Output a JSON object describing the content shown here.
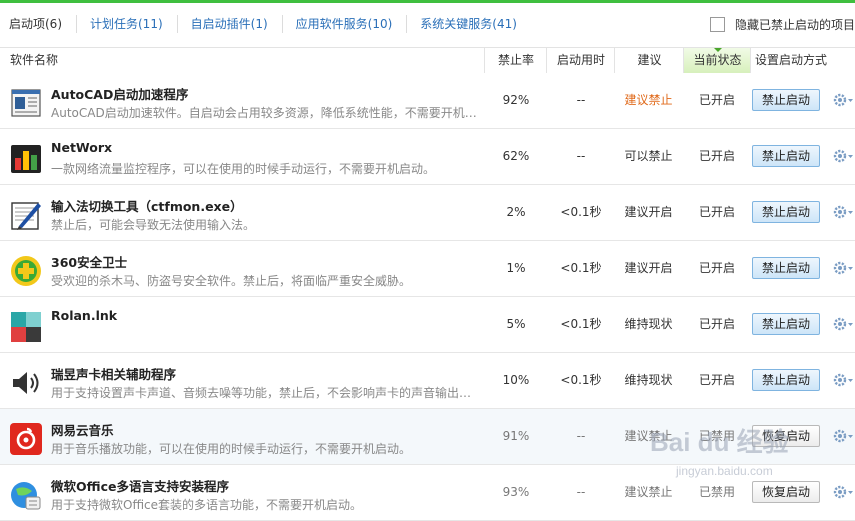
{
  "tabs": [
    {
      "label": "启动项(6)"
    },
    {
      "label": "计划任务(11)"
    },
    {
      "label": "自启动插件(1)"
    },
    {
      "label": "应用软件服务(10)"
    },
    {
      "label": "系统关键服务(41)"
    }
  ],
  "hide_disabled_label": "隐藏已禁止启动的项目",
  "columns": {
    "name": "软件名称",
    "disable_rate": "禁止率",
    "startup_time": "启动用时",
    "suggestion": "建议",
    "current_state": "当前状态",
    "startup_mode": "设置启动方式"
  },
  "rows": [
    {
      "name": "AutoCAD启动加速程序",
      "desc": "AutoCAD启动加速软件。自启动会占用较多资源，降低系统性能，不需要开机启动。",
      "rate": "92%",
      "time": "--",
      "suggestion": "建议禁止",
      "state": "已开启",
      "button": "禁止启动",
      "icon": "autocad-icon",
      "suggestion_color": "#e06a1b"
    },
    {
      "name": "NetWorx",
      "desc": "一款网络流量监控程序，可以在使用的时候手动运行，不需要开机启动。",
      "rate": "62%",
      "time": "--",
      "suggestion": "可以禁止",
      "state": "已开启",
      "button": "禁止启动",
      "icon": "networx-icon"
    },
    {
      "name": "输入法切换工具（ctfmon.exe）",
      "desc": "禁止后，可能会导致无法使用输入法。",
      "rate": "2%",
      "time": "<0.1秒",
      "suggestion": "建议开启",
      "state": "已开启",
      "button": "禁止启动",
      "icon": "ctfmon-icon"
    },
    {
      "name": "360安全卫士",
      "desc": "受欢迎的杀木马、防盗号安全软件。禁止后，将面临严重安全威胁。",
      "rate": "1%",
      "time": "<0.1秒",
      "suggestion": "建议开启",
      "state": "已开启",
      "button": "禁止启动",
      "icon": "360-icon"
    },
    {
      "name": "Rolan.lnk",
      "desc": "",
      "rate": "5%",
      "time": "<0.1秒",
      "suggestion": "维持现状",
      "state": "已开启",
      "button": "禁止启动",
      "icon": "rolan-icon"
    },
    {
      "name": "瑞昱声卡相关辅助程序",
      "desc": "用于支持设置声卡声道、音频去噪等功能，禁止后，不会影响声卡的声音输出功能。",
      "rate": "10%",
      "time": "<0.1秒",
      "suggestion": "维持现状",
      "state": "已开启",
      "button": "禁止启动",
      "icon": "speaker-icon"
    },
    {
      "name": "网易云音乐",
      "desc": "用于音乐播放功能，可以在使用的时候手动运行，不需要开机启动。",
      "rate": "91%",
      "time": "--",
      "suggestion": "建议禁止",
      "state": "已禁用",
      "button": "恢复启动",
      "icon": "netease-music-icon"
    },
    {
      "name": "微软Office多语言支持安装程序",
      "desc": "用于支持微软Office套装的多语言功能，不需要开机启动。",
      "rate": "93%",
      "time": "--",
      "suggestion": "建议禁止",
      "state": "已禁用",
      "button": "恢复启动",
      "icon": "office-icon"
    }
  ],
  "watermark": {
    "main": "Bai du 经验",
    "sub": "jingyan.baidu.com"
  }
}
